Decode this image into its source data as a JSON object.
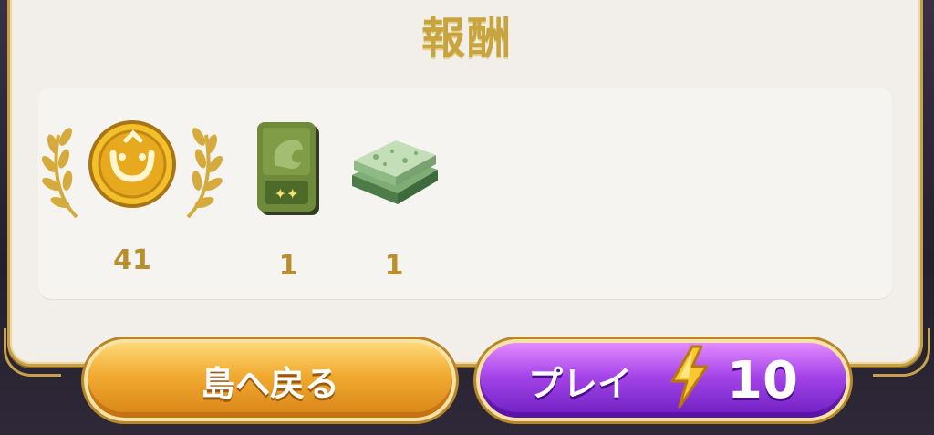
{
  "header": {
    "title": "報酬"
  },
  "rewards": [
    {
      "name": "coin",
      "icon": "medal-coin-icon",
      "count": "41"
    },
    {
      "name": "green-card",
      "icon": "green-card-icon",
      "count": "1"
    },
    {
      "name": "jade-tile",
      "icon": "jade-tile-icon",
      "count": "1"
    }
  ],
  "buttons": {
    "home_label": "島へ戻る",
    "play_label": "プレイ",
    "play_cost": "10"
  },
  "colors": {
    "gold_text": "#c7a43e",
    "orange_button": "#f0a92f",
    "purple_button": "#a443e8"
  }
}
